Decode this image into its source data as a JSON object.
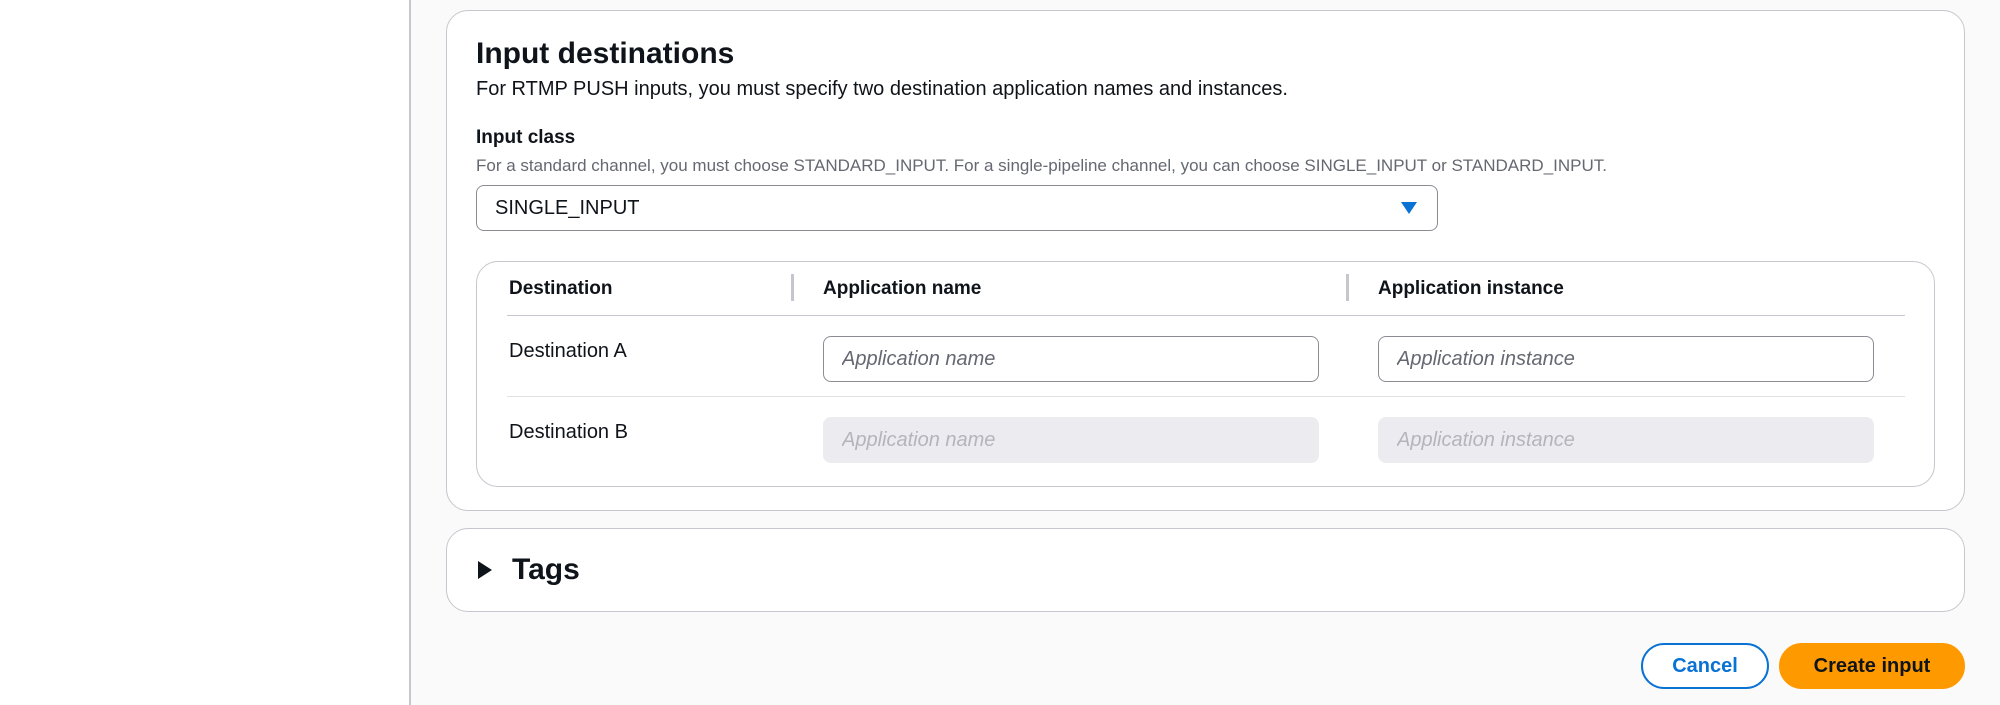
{
  "section": {
    "title": "Input destinations",
    "description": "For RTMP PUSH inputs, you must specify two destination application names and instances."
  },
  "input_class": {
    "label": "Input class",
    "description": "For a standard channel, you must choose STANDARD_INPUT. For a single-pipeline channel, you can choose SINGLE_INPUT or STANDARD_INPUT.",
    "selected": "SINGLE_INPUT"
  },
  "table": {
    "headers": [
      "Destination",
      "Application name",
      "Application instance"
    ],
    "rows": [
      {
        "destination": "Destination A",
        "app_name_placeholder": "Application name",
        "app_instance_placeholder": "Application instance",
        "disabled": false
      },
      {
        "destination": "Destination B",
        "app_name_placeholder": "Application name",
        "app_instance_placeholder": "Application instance",
        "disabled": true
      }
    ]
  },
  "tags": {
    "title": "Tags"
  },
  "actions": {
    "cancel_label": "Cancel",
    "create_label": "Create input"
  },
  "colors": {
    "accent": "#0972d3",
    "primary_button": "#ff9900",
    "border": "#c6c6cd"
  }
}
